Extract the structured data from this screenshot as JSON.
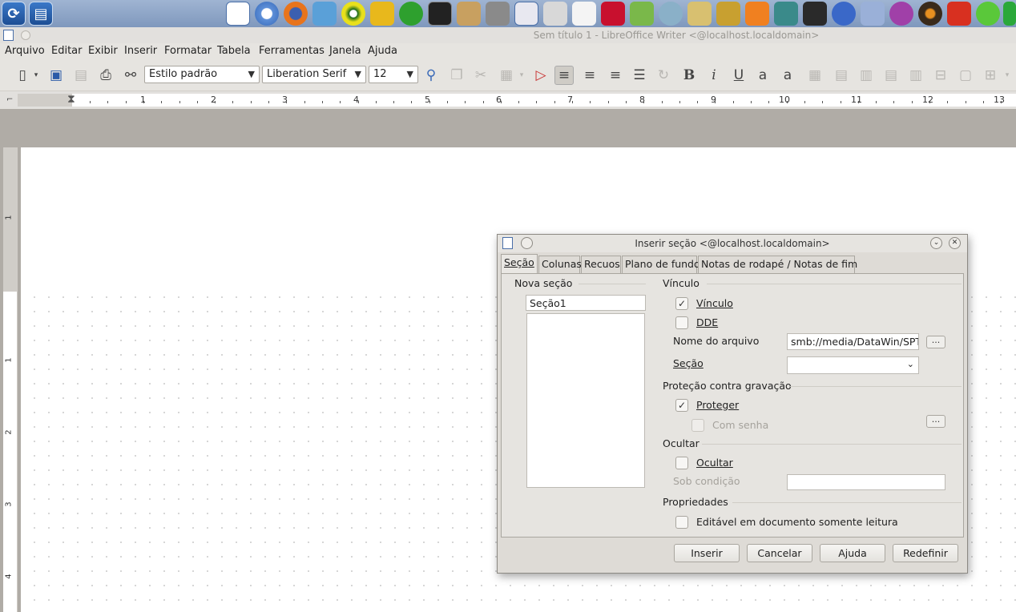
{
  "window": {
    "title": "Sem título 1 - LibreOffice Writer <@localhost.localdomain>"
  },
  "menubar": [
    "Arquivo",
    "Editar",
    "Exibir",
    "Inserir",
    "Formatar",
    "Tabela",
    "Ferramentas",
    "Janela",
    "Ajuda"
  ],
  "toolbar": {
    "paragraph_style": "Estilo padrão",
    "font_name": "Liberation Serif",
    "font_size": "12",
    "bold_glyph": "B",
    "italic_glyph": "i",
    "underline_glyph": "U"
  },
  "ruler": {
    "numbers": [
      "1",
      "2",
      "3",
      "4",
      "5",
      "6",
      "7",
      "8",
      "9",
      "10",
      "11",
      "12",
      "13"
    ]
  },
  "vruler": {
    "numbers": [
      "1",
      "1",
      "2",
      "3",
      "4"
    ]
  },
  "dialog": {
    "title": "Inserir seção <@localhost.localdomain>",
    "tabs": [
      "Seção",
      "Colunas",
      "Recuos",
      "Plano de fundo",
      "Notas de rodapé / Notas de fim"
    ],
    "new_section_label": "Nova seção",
    "section_name": "Seção1",
    "link_group": "Vínculo",
    "link_check": "Vínculo",
    "dde_check": "DDE",
    "filename_label": "Nome do arquivo",
    "filename_value": "smb://media/DataWin/SPTC",
    "browse_label": "...",
    "section_label": "Seção",
    "protection_group": "Proteção contra gravação",
    "protect_check": "Proteger",
    "password_check": "Com senha",
    "hide_group": "Ocultar",
    "hide_check": "Ocultar",
    "condition_label": "Sob condição",
    "properties_group": "Propriedades",
    "editable_check": "Editável em documento somente leitura",
    "buttons": {
      "insert": "Inserir",
      "cancel": "Cancelar",
      "help": "Ajuda",
      "reset": "Redefinir"
    }
  }
}
